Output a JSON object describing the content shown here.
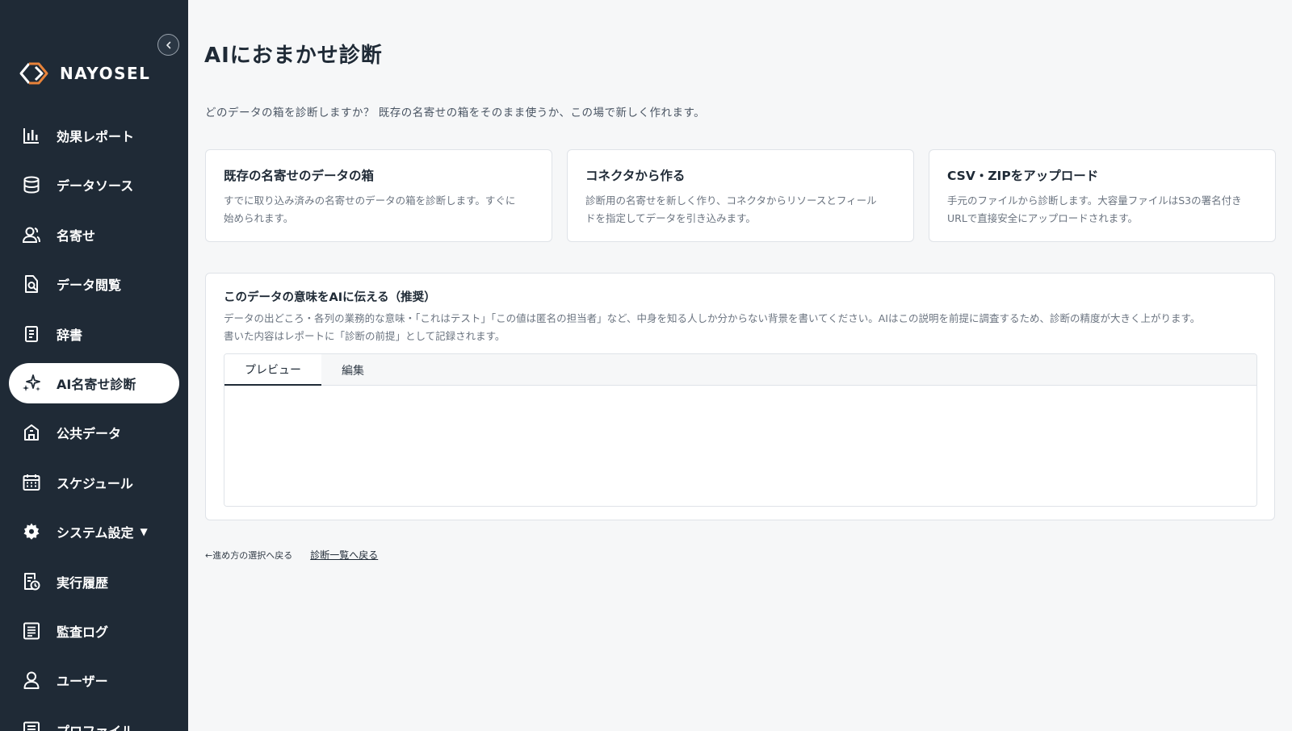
{
  "brand": {
    "name": "NAYOSEL"
  },
  "sidebar": {
    "items": [
      {
        "label": "効果レポート",
        "icon": "bar-chart-icon"
      },
      {
        "label": "データソース",
        "icon": "database-icon"
      },
      {
        "label": "名寄せ",
        "icon": "users-icon"
      },
      {
        "label": "データ閲覧",
        "icon": "document-search-icon"
      },
      {
        "label": "辞書",
        "icon": "book-icon"
      },
      {
        "label": "AI名寄せ診断",
        "icon": "sparkles-icon"
      },
      {
        "label": "公共データ",
        "icon": "building-icon"
      },
      {
        "label": "スケジュール",
        "icon": "calendar-icon"
      },
      {
        "label": "システム設定",
        "icon": "gear-icon",
        "caret": "▼"
      },
      {
        "label": "実行履歴",
        "icon": "history-icon"
      },
      {
        "label": "監査ログ",
        "icon": "log-icon"
      },
      {
        "label": "ユーザー",
        "icon": "user-icon"
      },
      {
        "label": "プロファイル",
        "icon": "profile-icon"
      }
    ],
    "active_index": 5
  },
  "main": {
    "title": "AIにおまかせ診断",
    "subtitle": "どのデータの箱を診断しますか？ 既存の名寄せの箱をそのまま使うか、この場で新しく作れます。",
    "cards": [
      {
        "title": "既存の名寄せのデータの箱",
        "desc_line1": "すでに取り込み済みの名寄せのデータの箱を診断します。すぐに",
        "desc_line2": "始められます。"
      },
      {
        "title": "コネクタから作る",
        "desc_line1": "診断用の名寄せを新しく作り、コネクタからリソースとフィール",
        "desc_line2": "ドを指定してデータを引き込みます。"
      },
      {
        "title": "CSV・ZIPをアップロード",
        "desc_line1": "手元のファイルから診断します。大容量ファイルはS3の署名付き",
        "desc_line2": "URLで直接安全にアップロードされます。"
      }
    ],
    "panel": {
      "title": "このデータの意味をAIに伝える（推奨）",
      "desc_line1": "データの出どころ・各列の業務的な意味・「これはテスト」「この値は匿名の担当者」など、中身を知る人しか分からない背景を書いてください。AIはこの説明を前提に調査するため、診断の精度が大きく上がります。",
      "desc_line2": "書いた内容はレポートに「診断の前提」として記録されます。",
      "tabs": {
        "preview": "プレビュー",
        "edit": "編集"
      }
    },
    "footer": {
      "back": "←進め方の選択へ戻る",
      "list": "診断一覧へ戻る"
    }
  },
  "colors": {
    "sidebar_bg": "#1f2a36",
    "accent_orange": "#e8833a",
    "page_bg": "#f6f7f8"
  }
}
